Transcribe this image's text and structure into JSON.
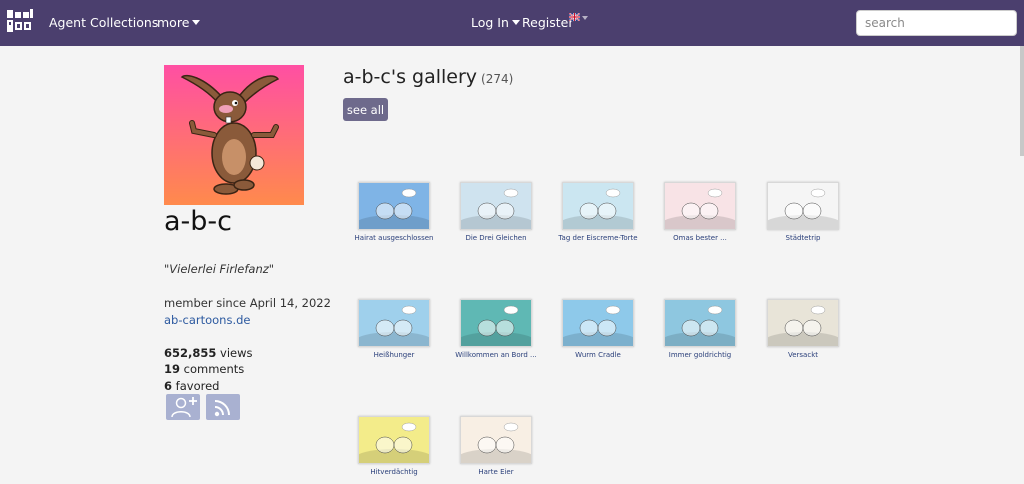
{
  "nav": {
    "agent": "Agent",
    "collections": "Collections",
    "more": "more",
    "login": "Log In",
    "register": "Register",
    "search_placeholder": "search"
  },
  "profile": {
    "name": "a-b-c",
    "motto": "\"Vielerlei Firlefanz\"",
    "member_since": "member since April 14, 2022",
    "website": "ab-cartoons.de",
    "views_count": "652,855",
    "views_label": "views",
    "comments_count": "19",
    "comments_label": "comments",
    "favored_count": "6",
    "favored_label": "favored"
  },
  "gallery": {
    "title": "a-b-c's gallery",
    "count": "(274)",
    "see_all": "see all",
    "items": [
      {
        "caption": "Hairat ausgeschlossen",
        "bg": "#7fb4e6"
      },
      {
        "caption": "Die Drei Gleichen",
        "bg": "#cfe3ef"
      },
      {
        "caption": "Tag der Eiscreme-Torte",
        "bg": "#cbe6f1"
      },
      {
        "caption": "Omas bester ...",
        "bg": "#f8e3e6"
      },
      {
        "caption": "Städtetrip",
        "bg": "#f5f5f5"
      },
      {
        "caption": "Heißhunger",
        "bg": "#9fd0ec"
      },
      {
        "caption": "Willkommen an Bord ...",
        "bg": "#5fb8b4"
      },
      {
        "caption": "Wurm Cradle",
        "bg": "#8ec9ea"
      },
      {
        "caption": "Immer goldrichtig",
        "bg": "#8ec7e0"
      },
      {
        "caption": "Versackt",
        "bg": "#e8e4d8"
      },
      {
        "caption": "Hitverdächtig",
        "bg": "#f3ec8a"
      },
      {
        "caption": "Harte Eier",
        "bg": "#f8efe4"
      }
    ]
  }
}
